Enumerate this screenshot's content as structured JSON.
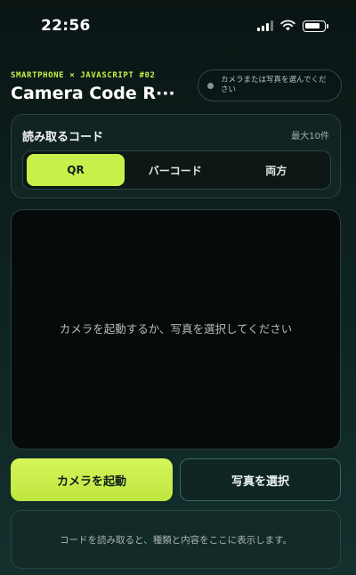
{
  "status_bar": {
    "time": "22:56"
  },
  "header": {
    "eyebrow": "SMARTPHONE × JAVASCRIPT #02",
    "title": "Camera Code R···",
    "status_text": "カメラまたは写真を選んでください"
  },
  "code_type": {
    "title": "読み取るコード",
    "limit": "最大10件",
    "options": [
      {
        "label": "QR",
        "selected": true
      },
      {
        "label": "バーコード",
        "selected": false
      },
      {
        "label": "両方",
        "selected": false
      }
    ]
  },
  "viewer": {
    "placeholder": "カメラを起動するか、写真を選択してください"
  },
  "actions": {
    "camera_label": "カメラを起動",
    "photo_label": "写真を選択"
  },
  "results": {
    "placeholder": "コードを読み取ると、種類と内容をここに表示します。"
  },
  "colors": {
    "accent": "#c8f04a",
    "background": "#0c1a19",
    "status_idle": "#8a9694"
  },
  "icons": [
    "cellular-signal-icon",
    "wifi-icon",
    "battery-icon"
  ]
}
